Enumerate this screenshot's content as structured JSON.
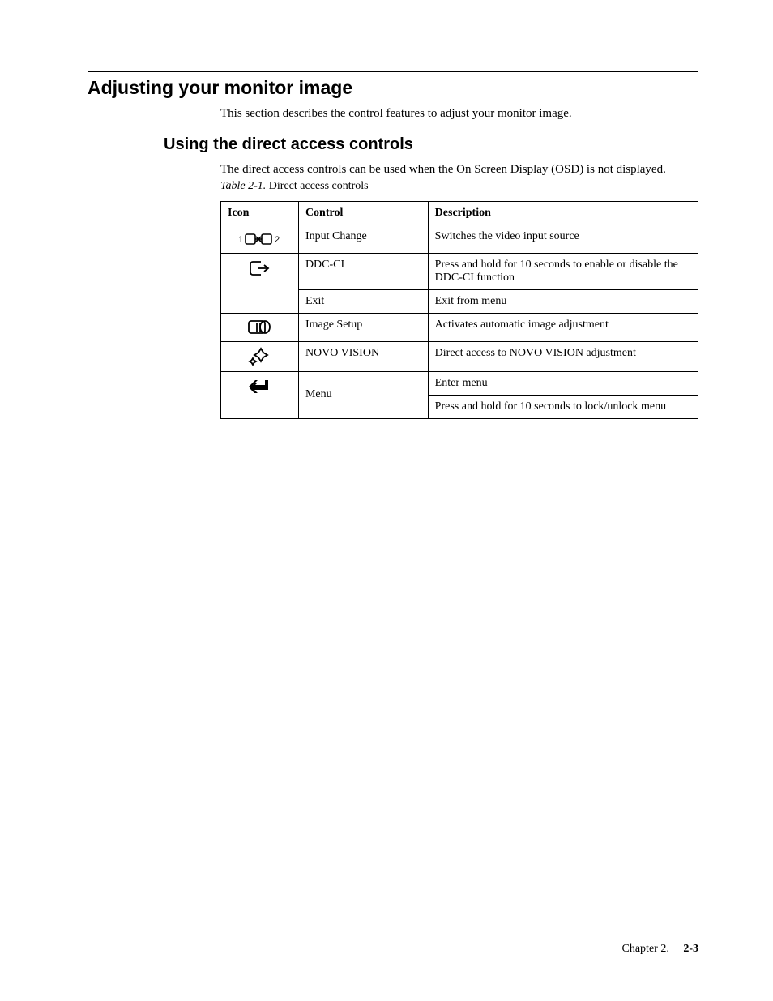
{
  "section": {
    "title": "Adjusting your monitor image",
    "intro": "This section describes the control features to adjust your monitor image."
  },
  "subsection": {
    "title": "Using the direct access controls",
    "intro": "The direct access controls can be used when the On Screen Display (OSD) is not displayed.",
    "caption_label": "Table 2-1.",
    "caption_text": " Direct access controls"
  },
  "table": {
    "headers": {
      "icon": "Icon",
      "control": "Control",
      "description": "Description"
    },
    "rows": {
      "r0": {
        "control": "Input Change",
        "desc": "Switches the video input source"
      },
      "r1": {
        "control": "DDC-CI",
        "desc": "Press and hold for 10 seconds to enable or disable the DDC-CI function"
      },
      "r2": {
        "control": "Exit",
        "desc": "Exit from menu"
      },
      "r3": {
        "control": "Image Setup",
        "desc": "Activates automatic image adjustment"
      },
      "r4": {
        "control": "NOVO VISION",
        "desc": "Direct access to NOVO VISION adjustment"
      },
      "r5": {
        "control": "Menu",
        "desc0": "Enter menu",
        "desc1": "Press and hold for 10 seconds to lock/unlock menu"
      }
    }
  },
  "footer": {
    "chapter": "Chapter 2.",
    "page": "2-3"
  }
}
